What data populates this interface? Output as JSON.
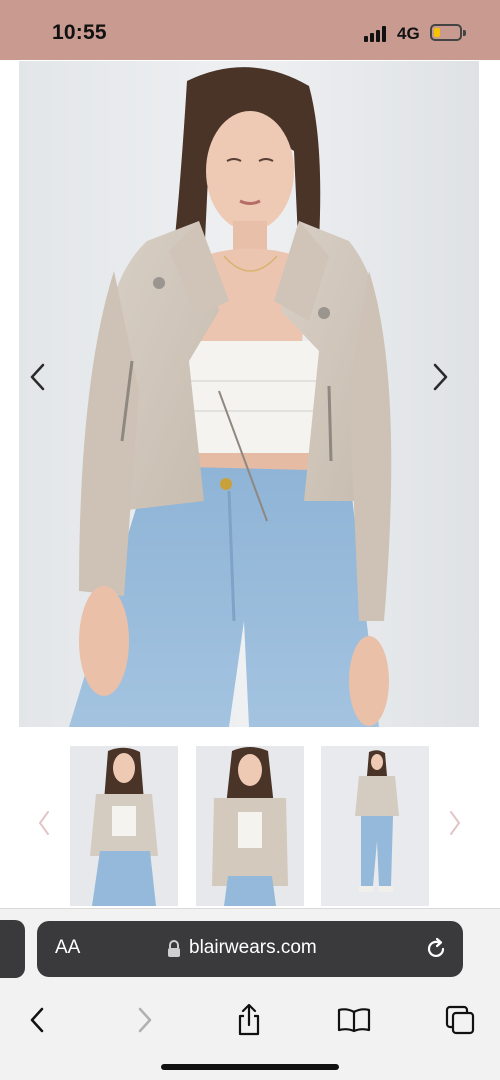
{
  "status_bar": {
    "time": "10:55",
    "network": "4G",
    "battery_level": 0.25,
    "signal_bars": 4
  },
  "product_gallery": {
    "main_image_alt": "Model wearing beige cropped faux leather biker jacket with white top and light blue jeans",
    "prev_icon": "chevron-left-icon",
    "next_icon": "chevron-right-icon",
    "thumbnails": [
      {
        "alt": "Front view of beige biker jacket"
      },
      {
        "alt": "Model holding jacket open"
      },
      {
        "alt": "Full length view with jeans and heels"
      }
    ]
  },
  "safari": {
    "text_size_label": "AA",
    "url": "blairwears.com",
    "icons": {
      "lock": "lock-icon",
      "reload": "reload-icon",
      "back": "chevron-left-icon",
      "forward": "chevron-right-icon",
      "share": "share-icon",
      "bookmarks": "book-icon",
      "tabs": "tabs-icon"
    }
  },
  "colors": {
    "status_bar": "#c89a90",
    "address_bar": "#3a3a3c",
    "toolbar_blue_icons": "#111111"
  }
}
